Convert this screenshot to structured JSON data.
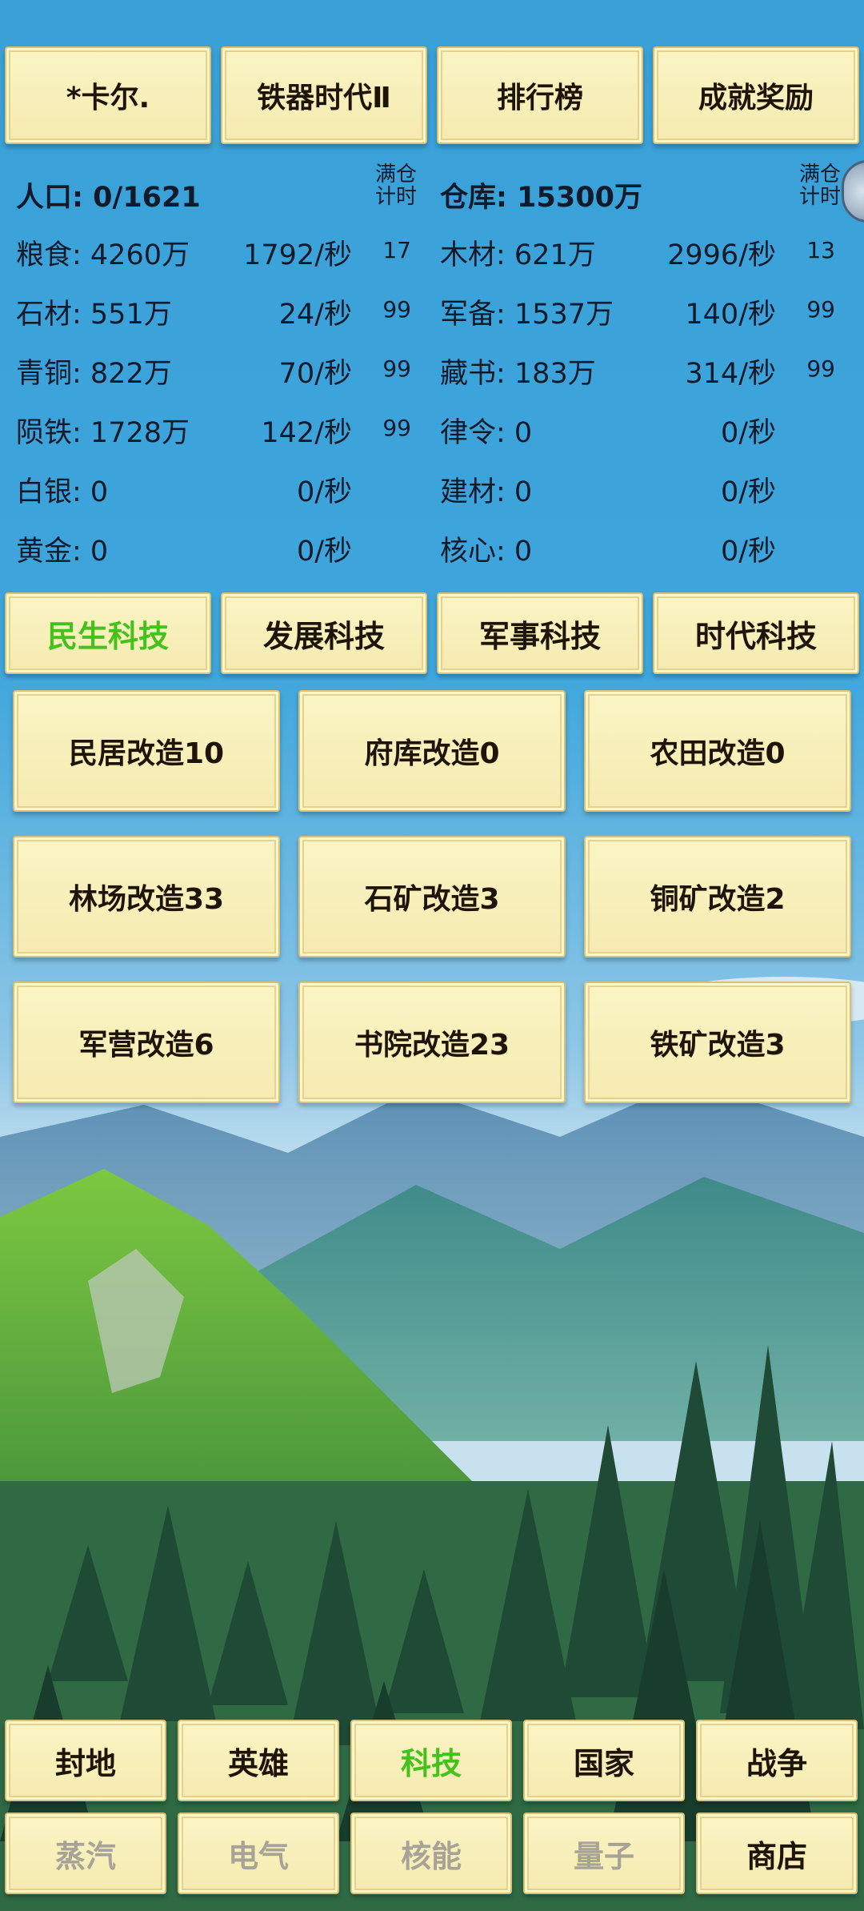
{
  "top_buttons": [
    "*卡尔.",
    "铁器时代Ⅱ",
    "排行榜",
    "成就奖励"
  ],
  "header": {
    "population": "人口: 0/1621",
    "full_timer_label_1": "满仓\n计时",
    "warehouse": "仓库: 15300万",
    "full_timer_label_2": "满仓\n计时"
  },
  "resources_left": [
    {
      "name": "粮食: 4260万",
      "rate": "1792/秒",
      "count": "17"
    },
    {
      "name": "石材: 551万",
      "rate": "24/秒",
      "count": "99"
    },
    {
      "name": "青铜: 822万",
      "rate": "70/秒",
      "count": "99"
    },
    {
      "name": "陨铁: 1728万",
      "rate": "142/秒",
      "count": "99"
    },
    {
      "name": "白银: 0",
      "rate": "0/秒",
      "count": ""
    },
    {
      "name": "黄金: 0",
      "rate": "0/秒",
      "count": ""
    }
  ],
  "resources_right": [
    {
      "name": "木材: 621万",
      "rate": "2996/秒",
      "count": "13"
    },
    {
      "name": "军备: 1537万",
      "rate": "140/秒",
      "count": "99"
    },
    {
      "name": "藏书: 183万",
      "rate": "314/秒",
      "count": "99"
    },
    {
      "name": "律令: 0",
      "rate": "0/秒",
      "count": ""
    },
    {
      "name": "建材: 0",
      "rate": "0/秒",
      "count": ""
    },
    {
      "name": "核心: 0",
      "rate": "0/秒",
      "count": ""
    }
  ],
  "tech_tabs": [
    "民生科技",
    "发展科技",
    "军事科技",
    "时代科技"
  ],
  "tech_items": [
    "民居改造10",
    "府库改造0",
    "农田改造0",
    "林场改造33",
    "石矿改造3",
    "铜矿改造2",
    "军营改造6",
    "书院改造23",
    "铁矿改造3"
  ],
  "bottom_nav_row1": [
    "封地",
    "英雄",
    "科技",
    "国家",
    "战争"
  ],
  "bottom_nav_row2": [
    "蒸汽",
    "电气",
    "核能",
    "量子",
    "商店"
  ],
  "colors": {
    "active_tab": "#43c21c",
    "disabled": "#a7a396",
    "sky": "#3aa0d8"
  }
}
